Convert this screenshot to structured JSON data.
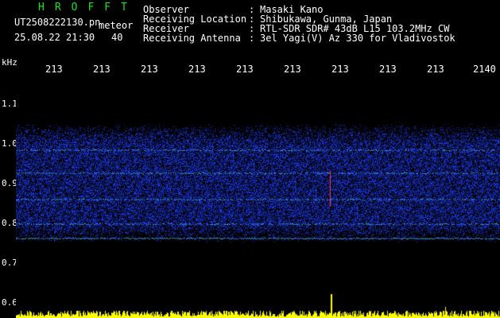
{
  "header": {
    "title_letters": "HROFFT",
    "filename": "UT2508222130.pn",
    "type": "meteor",
    "datetime": "25.08.22 21:30",
    "count": "40",
    "fields": [
      {
        "label": "Observer",
        "sep": ":",
        "value": "Masaki Kano"
      },
      {
        "label": "Receiving Location",
        "sep": ":",
        "value": "Shibukawa, Gunma, Japan"
      },
      {
        "label": "Receiver",
        "sep": ":",
        "value": "RTL-SDR SDR# 43dB L15 103.2MHz CW"
      },
      {
        "label": "Receiving Antenna",
        "sep": ":",
        "value": "3el Yagi(V) Az 330 for Vladivostok"
      }
    ]
  },
  "axes": {
    "y_unit": "kHz",
    "y_ticks": [
      "1.1",
      "1.0",
      "0.9",
      "0.8",
      "0.7",
      "0.6"
    ],
    "x_ticks": [
      "213",
      "213",
      "213",
      "213",
      "213",
      "213",
      "213",
      "213",
      "213",
      "2140"
    ]
  },
  "colors": {
    "background": "#000000",
    "text": "#ffffff",
    "title": "#14e61e",
    "noise": "#1428c8",
    "signal": "#28c8b4",
    "bars": "#ffff00",
    "spike": "#ff3232"
  }
}
